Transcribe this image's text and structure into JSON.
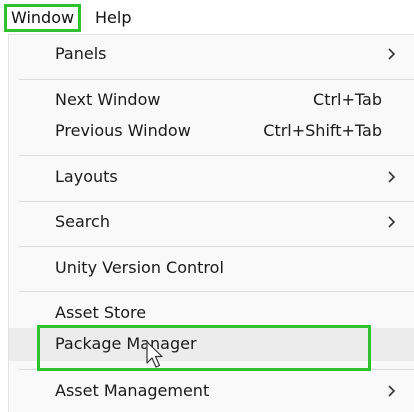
{
  "menubar": {
    "items": [
      {
        "label": "Window"
      },
      {
        "label": "Help"
      }
    ]
  },
  "menu": {
    "items": [
      {
        "label": "Panels",
        "shortcut": "",
        "submenu": true
      },
      {
        "label": "Next Window",
        "shortcut": "Ctrl+Tab",
        "submenu": false
      },
      {
        "label": "Previous Window",
        "shortcut": "Ctrl+Shift+Tab",
        "submenu": false
      },
      {
        "label": "Layouts",
        "shortcut": "",
        "submenu": true
      },
      {
        "label": "Search",
        "shortcut": "",
        "submenu": true
      },
      {
        "label": "Unity Version Control",
        "shortcut": "",
        "submenu": false
      },
      {
        "label": "Asset Store",
        "shortcut": "",
        "submenu": false
      },
      {
        "label": "Package Manager",
        "shortcut": "",
        "submenu": false
      },
      {
        "label": "Asset Management",
        "shortcut": "",
        "submenu": true
      }
    ]
  },
  "colors": {
    "highlight": "#2fc22f",
    "menu_background": "#f9f9f9",
    "hover_background": "#ececec"
  },
  "icons": {
    "submenu": "chevron-right-icon",
    "pointer": "mouse-pointer-icon"
  }
}
